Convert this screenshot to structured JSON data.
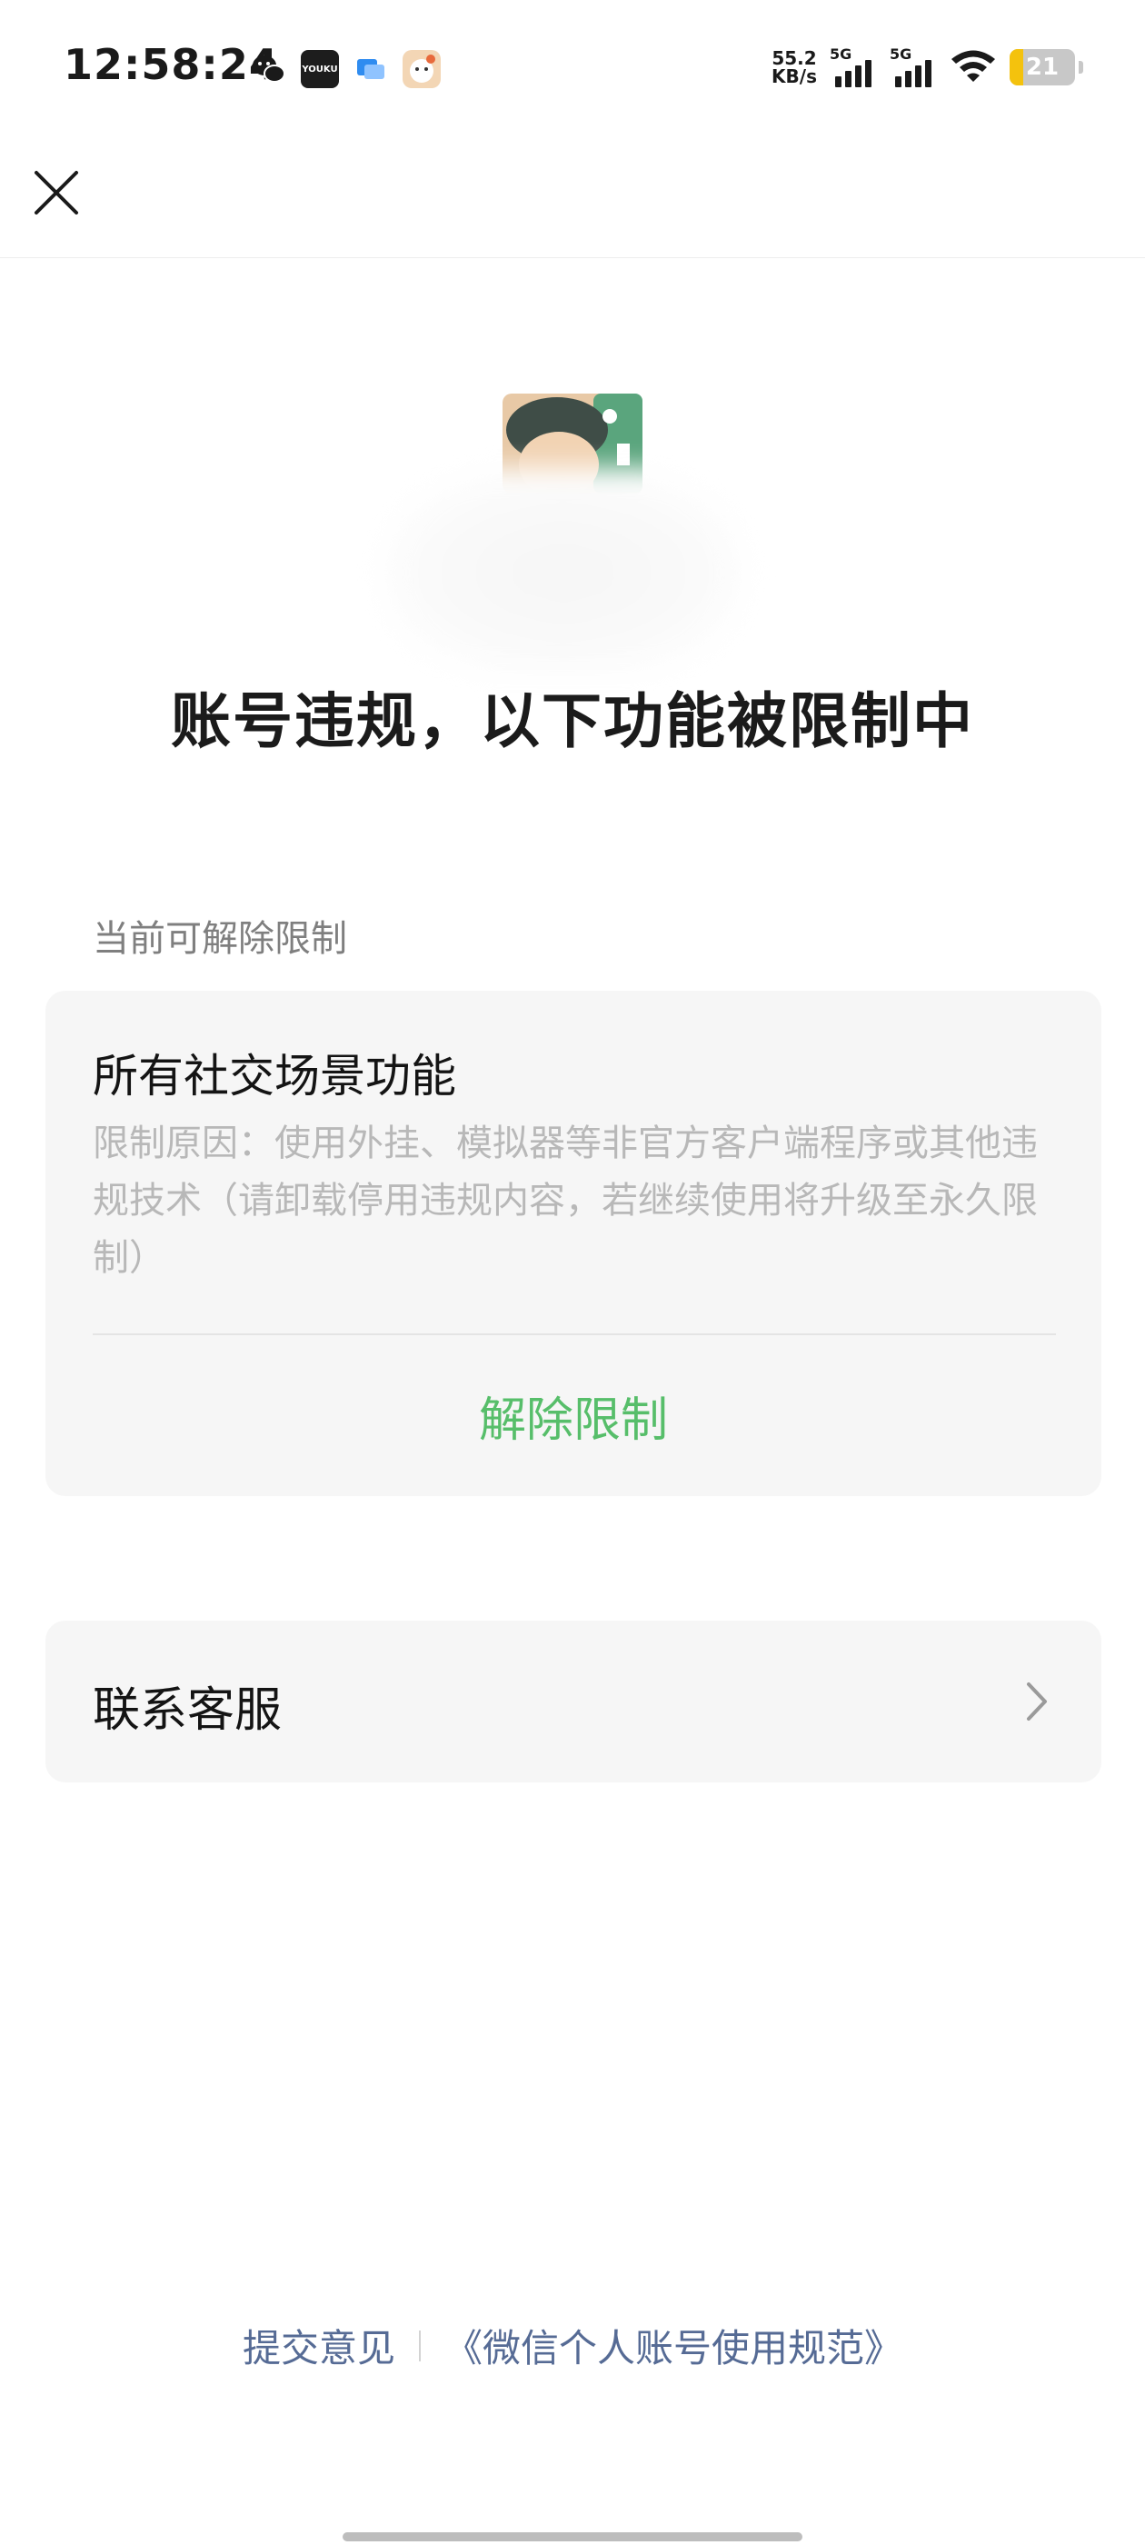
{
  "status_bar": {
    "time": "12:58:24",
    "net_speed_value": "55.2",
    "net_speed_unit": "KB/s",
    "signal_1_label": "5G",
    "signal_2_label": "5G",
    "battery_level": "21",
    "battery_fraction": 0.21,
    "youku_label": "YOUKU",
    "app_icons": [
      "wechat-icon",
      "youku-icon",
      "message-icon",
      "avatar-app-icon"
    ]
  },
  "nav": {
    "close_icon": "close-icon"
  },
  "hero": {
    "headline": "账号违规，以下功能被限制中"
  },
  "section": {
    "label": "当前可解除限制"
  },
  "restriction_card": {
    "title": "所有社交场景功能",
    "reason": "限制原因：使用外挂、模拟器等非官方客户端程序或其他违规技术（请卸载停用违规内容，若继续使用将升级至永久限制）",
    "action_label": "解除限制"
  },
  "contact": {
    "label": "联系客服",
    "icon": "chevron-right-icon"
  },
  "footer": {
    "feedback_link": "提交意见",
    "policy_link": "《微信个人账号使用规范》"
  },
  "colors": {
    "accent_green": "#57be6a",
    "link_blue": "#566b95",
    "card_bg": "#f6f6f6",
    "battery_yellow": "#f4c20d"
  }
}
